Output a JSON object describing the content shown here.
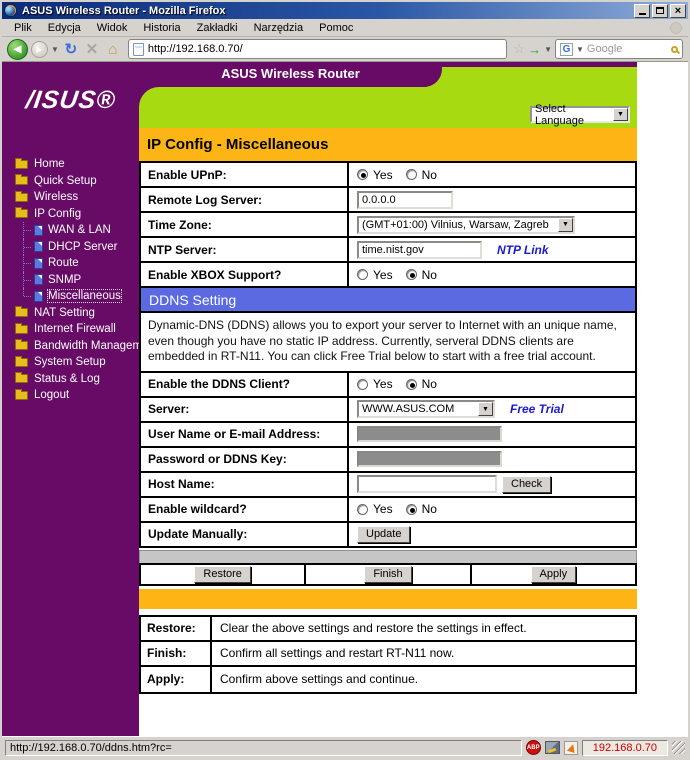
{
  "window": {
    "title": "ASUS Wireless Router - Mozilla Firefox",
    "menu": [
      "Plik",
      "Edycja",
      "Widok",
      "Historia",
      "Zakładki",
      "Narzędzia",
      "Pomoc"
    ],
    "address_url": "http://192.168.0.70/",
    "search_placeholder": "Google",
    "search_engine_initial": "G"
  },
  "status": {
    "url": "http://192.168.0.70/ddns.htm?rc=",
    "host": "192.168.0.70",
    "abp": "ABP"
  },
  "sidebar": {
    "logo": "/ISUS®",
    "items": [
      {
        "label": "Home"
      },
      {
        "label": "Quick Setup"
      },
      {
        "label": "Wireless"
      },
      {
        "label": "IP Config"
      },
      {
        "label": "WAN & LAN"
      },
      {
        "label": "DHCP Server"
      },
      {
        "label": "Route"
      },
      {
        "label": "SNMP"
      },
      {
        "label": "Miscellaneous",
        "selected": true
      },
      {
        "label": "NAT Setting"
      },
      {
        "label": "Internet Firewall"
      },
      {
        "label": "Bandwidth Management"
      },
      {
        "label": "System Setup"
      },
      {
        "label": "Status & Log"
      },
      {
        "label": "Logout"
      }
    ]
  },
  "header": {
    "tab_title": "ASUS Wireless Router",
    "language": "Select Language",
    "page_title": "IP Config - Miscellaneous"
  },
  "misc": {
    "labels": {
      "yes": "Yes",
      "no": "No"
    },
    "rows": {
      "upnp": {
        "label": "Enable UPnP:",
        "selected": "yes"
      },
      "remote_log": {
        "label": "Remote Log Server:",
        "value": "0.0.0.0"
      },
      "time_zone": {
        "label": "Time Zone:",
        "value": "(GMT+01:00) Vilnius, Warsaw, Zagreb"
      },
      "ntp": {
        "label": "NTP Server:",
        "value": "time.nist.gov",
        "link": "NTP Link"
      },
      "xbox": {
        "label": "Enable XBOX Support?",
        "selected": "no"
      }
    }
  },
  "ddns": {
    "title": "DDNS Setting",
    "description": "Dynamic-DNS (DDNS) allows you to export your server to Internet with an unique name, even though you have no static IP address. Currently, serveral DDNS clients are embedded in RT-N11. You can click Free Trial below to start with a free trial account.",
    "rows": {
      "client": {
        "label": "Enable the DDNS Client?",
        "selected": "no"
      },
      "server": {
        "label": "Server:",
        "value": "WWW.ASUS.COM",
        "link": "Free Trial"
      },
      "username": {
        "label": "User Name or E-mail Address:"
      },
      "password": {
        "label": "Password or DDNS Key:"
      },
      "hostname": {
        "label": "Host Name:",
        "value": "",
        "button": "Check"
      },
      "wildcard": {
        "label": "Enable wildcard?",
        "selected": "no"
      },
      "update": {
        "label": "Update Manually:",
        "button": "Update"
      }
    }
  },
  "actions": {
    "restore": "Restore",
    "finish": "Finish",
    "apply": "Apply"
  },
  "help": {
    "rows": [
      {
        "term": "Restore:",
        "text": "Clear the above settings and restore the settings in effect."
      },
      {
        "term": "Finish:",
        "text": "Confirm all settings and restart RT-N11 now."
      },
      {
        "term": "Apply:",
        "text": "Confirm above settings and continue."
      }
    ]
  },
  "colors": {
    "sidebar_purple": "#670b67",
    "header_green": "#a8da11",
    "banner_orange": "#fdb515",
    "ddns_blue": "#5b6ae0",
    "link_blue": "#1a1acd",
    "status_red": "#cc0000"
  }
}
